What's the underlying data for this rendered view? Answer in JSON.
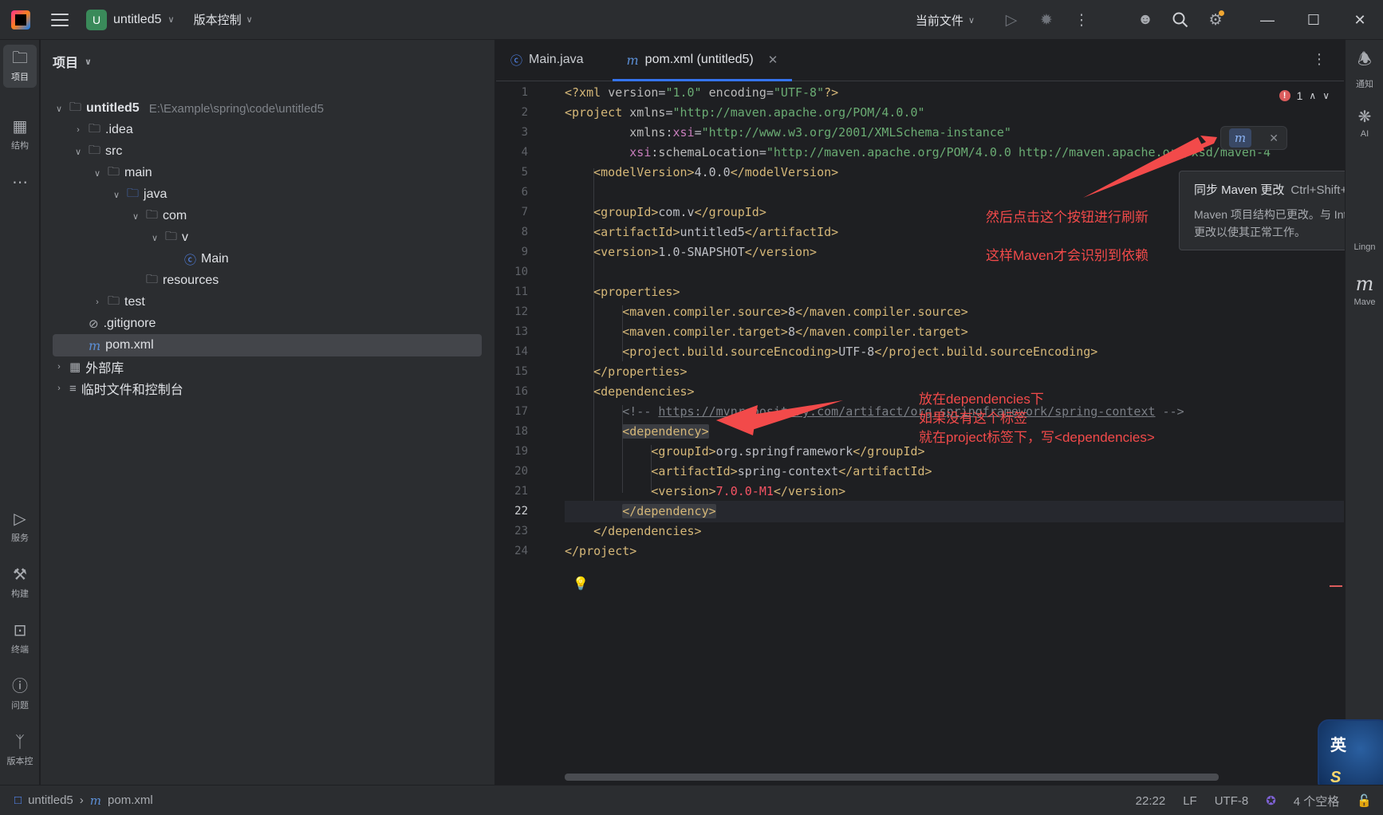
{
  "titlebar": {
    "project_badge": "U",
    "project_name": "untitled5",
    "vcs_label": "版本控制",
    "run_config": "当前文件"
  },
  "left_strip": {
    "items": [
      {
        "label": "项目",
        "icon": "folder-icon"
      },
      {
        "label": "结构",
        "icon": "structure-icon"
      },
      {
        "label": "服务",
        "icon": "services-icon"
      },
      {
        "label": "构建",
        "icon": "build-icon"
      },
      {
        "label": "终端",
        "icon": "terminal-icon"
      },
      {
        "label": "问题",
        "icon": "problems-icon"
      },
      {
        "label": "版本控",
        "icon": "git-icon"
      }
    ]
  },
  "project_panel": {
    "title": "项目",
    "tree": [
      {
        "name": "untitled5",
        "path": "E:\\Example\\spring\\code\\untitled5",
        "bold": true
      },
      {
        "name": ".idea"
      },
      {
        "name": "src"
      },
      {
        "name": "main"
      },
      {
        "name": "java"
      },
      {
        "name": "com"
      },
      {
        "name": "v"
      },
      {
        "name": "Main"
      },
      {
        "name": "resources"
      },
      {
        "name": "test"
      },
      {
        "name": ".gitignore"
      },
      {
        "name": "pom.xml"
      },
      {
        "name": "外部库"
      },
      {
        "name": "临时文件和控制台"
      }
    ]
  },
  "editor": {
    "tabs": [
      {
        "label": "Main.java"
      },
      {
        "label": "pom.xml (untitled5)"
      }
    ],
    "error_count": "1",
    "line_numbers": [
      "1",
      "2",
      "3",
      "4",
      "5",
      "6",
      "7",
      "8",
      "9",
      "10",
      "11",
      "12",
      "13",
      "14",
      "15",
      "16",
      "17",
      "18",
      "19",
      "20",
      "21",
      "22",
      "23",
      "24"
    ],
    "current_line": 22,
    "sync_icon": "maven-sync-icon"
  },
  "tooltip": {
    "title": "同步 Maven 更改",
    "shortcut": "Ctrl+Shift+O",
    "body_line1": "Maven 项目结构已更改。与 IntelliJ",
    "body_line2": "更改以使其正常工作。"
  },
  "right_strip": {
    "items": [
      {
        "label": "通知",
        "icon": "bell-icon"
      },
      {
        "label": "AI",
        "icon": "ai-icon"
      },
      {
        "label": "Lingn",
        "icon": "lingma-icon"
      },
      {
        "label": "Mave",
        "icon": "maven-icon"
      }
    ]
  },
  "annotations": {
    "note1": "然后点击这个按钮进行刷新",
    "note2": "这样Maven才会识别到依赖",
    "note3_line1": "放在dependencies下",
    "note3_line2": "如果没有这个标签",
    "note3_line3": "就在project标签下，写<dependencies>"
  },
  "ime": {
    "char": "英",
    "letter": "S"
  },
  "statusbar": {
    "crumb_project": "untitled5",
    "crumb_file": "pom.xml",
    "position": "22:22",
    "line_sep": "LF",
    "encoding": "UTF-8",
    "indent": "4 个空格"
  },
  "colors": {
    "accent": "#3574f0",
    "annotation": "#f24a4a",
    "background": "#1e1f22",
    "panel": "#2b2d30"
  }
}
